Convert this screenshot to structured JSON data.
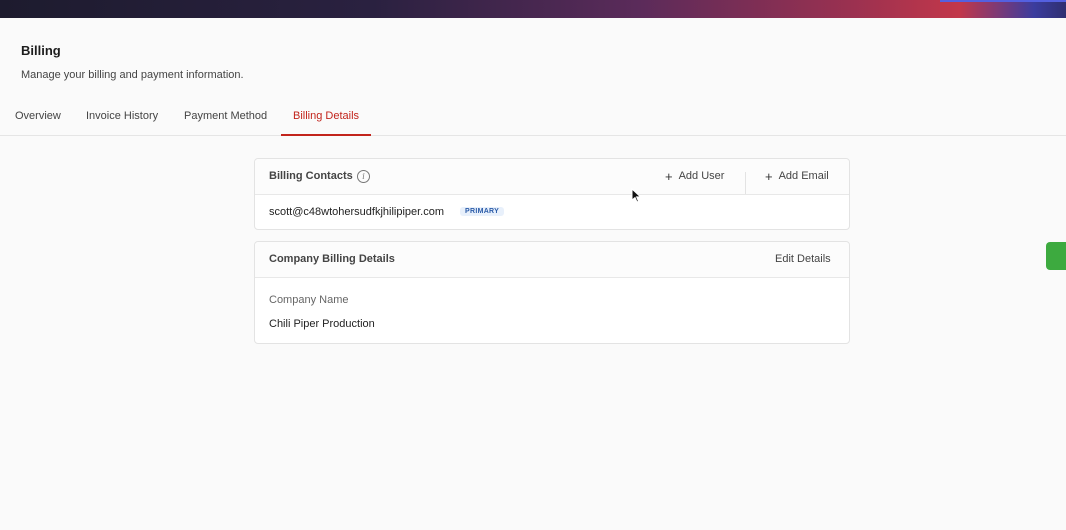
{
  "page": {
    "title": "Billing",
    "subtitle": "Manage your billing and payment information."
  },
  "tabs": [
    {
      "label": "Overview",
      "active": false
    },
    {
      "label": "Invoice History",
      "active": false
    },
    {
      "label": "Payment Method",
      "active": false
    },
    {
      "label": "Billing Details",
      "active": true
    }
  ],
  "billing_contacts": {
    "title": "Billing Contacts",
    "info_icon": "info-icon",
    "add_user_label": "Add User",
    "add_email_label": "Add Email",
    "contacts": [
      {
        "email": "scott@c48wtohersudfkjhilipiper.com",
        "badge": "PRIMARY"
      }
    ]
  },
  "company_billing": {
    "title": "Company Billing Details",
    "edit_label": "Edit Details",
    "fields": [
      {
        "label": "Company Name",
        "value": "Chili Piper Production"
      }
    ]
  },
  "colors": {
    "accent": "#c2241c",
    "badge_text": "#2a5ba8",
    "badge_bg": "#e8f0fb",
    "side_tab": "#3daa3f"
  }
}
